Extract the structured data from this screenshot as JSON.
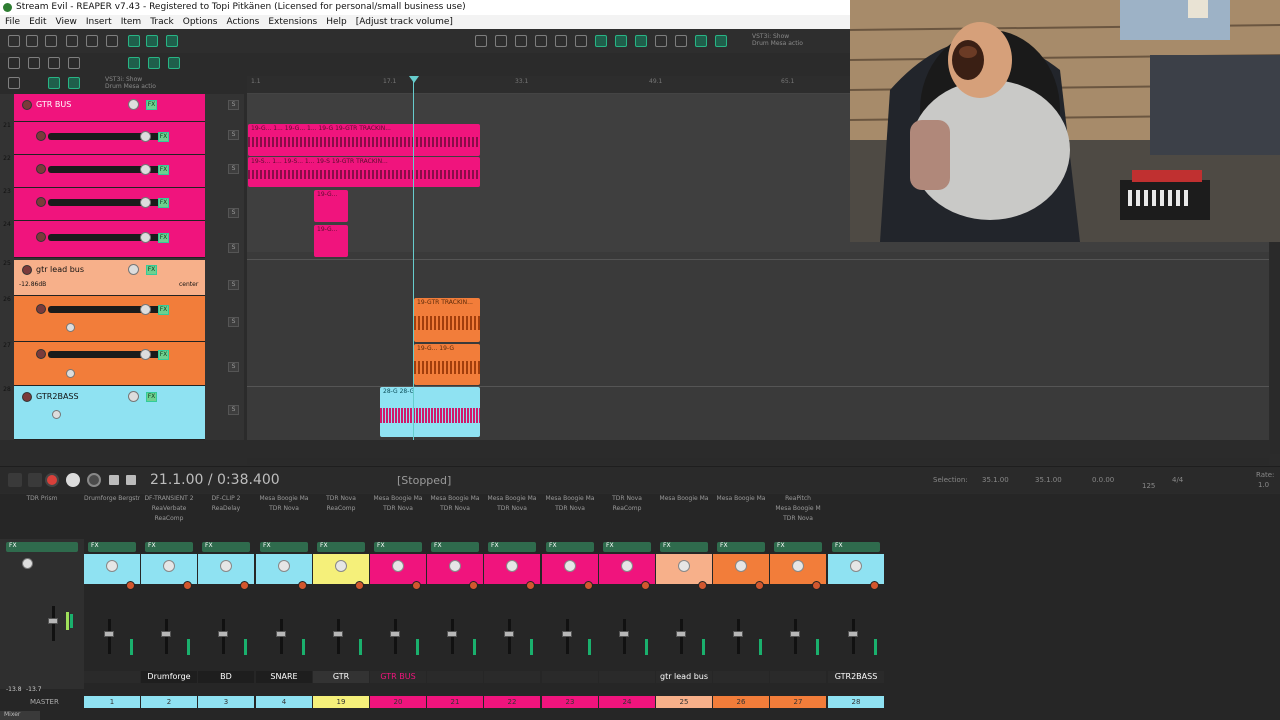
{
  "window": {
    "title": "Stream Evil - REAPER v7.43 - Registered to Topi Pitkänen (Licensed for personal/small business use)"
  },
  "menu": [
    "File",
    "Edit",
    "View",
    "Insert",
    "Item",
    "Track",
    "Options",
    "Actions",
    "Extensions",
    "Help",
    "[Adjust track volume]"
  ],
  "toolbar": {
    "vst_label_top": "VST3i: Show",
    "vst_label_bottom": "Drum Mesa  actio"
  },
  "ruler": [
    "1.1",
    "17.1",
    "33.1",
    "49.1",
    "65.1"
  ],
  "tracks": [
    {
      "name": "GTR BUS",
      "num": "",
      "color": "#f0147d"
    },
    {
      "name": "",
      "num": "21",
      "color": "#f0147d"
    },
    {
      "name": "",
      "num": "22",
      "color": "#f0147d"
    },
    {
      "name": "",
      "num": "23",
      "color": "#f0147d"
    },
    {
      "name": "",
      "num": "24",
      "color": "#f0147d"
    },
    {
      "name": "gtr lead bus",
      "num": "25",
      "color": "#f7b08a",
      "volume": "-12.86dB",
      "pan": "center"
    },
    {
      "name": "",
      "num": "26",
      "color": "#f27d3a"
    },
    {
      "name": "",
      "num": "27",
      "color": "#f27d3a"
    },
    {
      "name": "GTR2BASS",
      "num": "28",
      "color": "#8fe2f2"
    }
  ],
  "items": [
    {
      "label": "19-G...  1...  19-G...  1...  19-G  19-GTR TRACKIN..."
    },
    {
      "label": "19-S...  1...  19-S...  1...  19-S  19-GTR TRACKIN..."
    },
    {
      "label": "19-G..."
    },
    {
      "label": "19-G..."
    },
    {
      "label": "19-GTR TRACKIN..."
    },
    {
      "label": "19-G...    19-G"
    },
    {
      "label": "28-G      28-G"
    }
  ],
  "transport": {
    "time": "21.1.00 / 0:38.400",
    "status": "[Stopped]",
    "selection_label": "Selection:",
    "sel_start": "35.1.00",
    "sel_end": "35.1.00",
    "sel_len": "0.0.00",
    "bpm": "125",
    "time_sig": "4/4",
    "rate_label": "Rate:",
    "rate_value": "1.0"
  },
  "mixer": {
    "fx_chains": [
      {
        "lines": [
          "TDR Prism"
        ]
      },
      {
        "lines": [
          "Drumforge Bergstrand"
        ]
      },
      {
        "lines": [
          "DF-TRANSIENT 2",
          "ReaVerbate",
          "ReaComp"
        ]
      },
      {
        "lines": [
          "DF-CLIP 2",
          "ReaDelay"
        ]
      },
      {
        "lines": [
          "Mesa Boogie Ma",
          "TDR Nova"
        ]
      },
      {
        "lines": [
          "TDR Nova",
          "ReaComp"
        ]
      },
      {
        "lines": [
          "Mesa Boogie Ma",
          "TDR Nova"
        ]
      },
      {
        "lines": [
          "Mesa Boogie Ma",
          "TDR Nova"
        ]
      },
      {
        "lines": [
          "Mesa Boogie Ma",
          "TDR Nova"
        ]
      },
      {
        "lines": [
          "Mesa Boogie Ma",
          "TDR Nova"
        ]
      },
      {
        "lines": [
          "TDR Nova",
          "ReaComp"
        ]
      },
      {
        "lines": [
          "Mesa Boogie Ma"
        ]
      },
      {
        "lines": [
          "Mesa Boogie Ma"
        ]
      },
      {
        "lines": [
          "ReaPitch",
          "Mesa Boogie M",
          "TDR Nova"
        ]
      }
    ],
    "strips": [
      {
        "name": "",
        "num": "1",
        "color": "#8fe2f2"
      },
      {
        "name": "Drumforge Bergstrand",
        "num": "2",
        "color": "#8fe2f2"
      },
      {
        "name": "BD",
        "num": "3",
        "color": "#8fe2f2"
      },
      {
        "name": "SNARE",
        "num": "4",
        "color": "#8fe2f2"
      },
      {
        "name": "GTR TRACKING",
        "num": "19",
        "color": "#f5f07a"
      },
      {
        "name": "GTR BUS",
        "num": "20",
        "color": "#f0147d"
      },
      {
        "name": "",
        "num": "21",
        "color": "#f0147d"
      },
      {
        "name": "",
        "num": "22",
        "color": "#f0147d"
      },
      {
        "name": "",
        "num": "23",
        "color": "#f0147d"
      },
      {
        "name": "",
        "num": "24",
        "color": "#f0147d"
      },
      {
        "name": "gtr lead bus",
        "num": "25",
        "color": "#f7b08a"
      },
      {
        "name": "",
        "num": "26",
        "color": "#f27d3a"
      },
      {
        "name": "",
        "num": "27",
        "color": "#f27d3a"
      },
      {
        "name": "GTR2BASS",
        "num": "28",
        "color": "#8fe2f2"
      }
    ],
    "master_label": "MASTER",
    "master_left": "-13.8",
    "master_right": "-13.7",
    "mixer_tab": "Mixer"
  }
}
